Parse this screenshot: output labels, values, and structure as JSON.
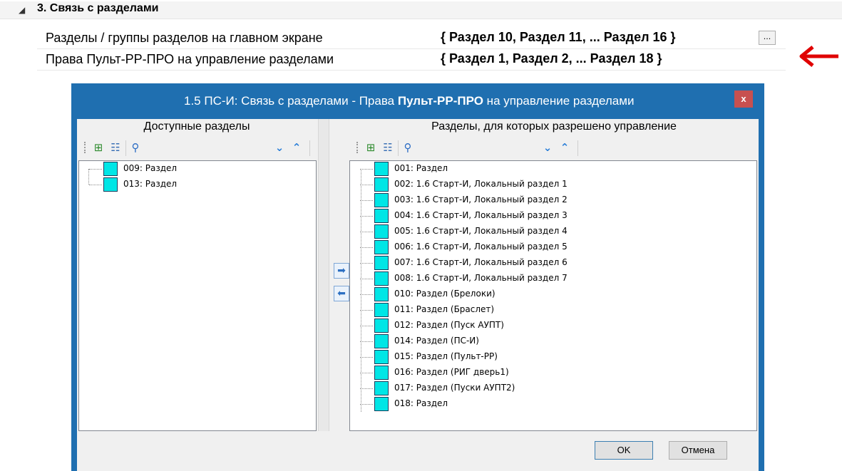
{
  "property_grid": {
    "group_title": "3. Связь с разделами",
    "rows": [
      {
        "name": "Разделы / группы разделов на главном экране",
        "value": "{ Раздел 10, Раздел 11, ... Раздел 16 }",
        "button": "..."
      },
      {
        "name": "Права Пульт-РР-ПРО на управление разделами",
        "value": "{ Раздел 1, Раздел 2, ... Раздел 18 }"
      }
    ]
  },
  "dialog": {
    "title_pre": "1.5 ПС-И: Связь с разделами - Права ",
    "title_bold": "Пульт-РР-ПРО",
    "title_post": " на управление разделами",
    "close": "x",
    "left_header": "Доступные разделы",
    "right_header": "Разделы, для которых разрешено управление",
    "available": [
      "009: Раздел",
      "013: Раздел"
    ],
    "allowed": [
      "001: Раздел",
      "002: 1.6 Старт-И, Локальный раздел 1",
      "003: 1.6 Старт-И, Локальный раздел 2",
      "004: 1.6 Старт-И, Локальный раздел 3",
      "005: 1.6 Старт-И, Локальный раздел 4",
      "006: 1.6 Старт-И, Локальный раздел 5",
      "007: 1.6 Старт-И, Локальный раздел 6",
      "008: 1.6 Старт-И, Локальный раздел 7",
      "010: Раздел (Брелоки)",
      "011: Раздел (Браслет)",
      "012: Раздел (Пуск АУПТ)",
      "014: Раздел (ПС-И)",
      "015: Раздел (Пульт-РР)",
      "016: Раздел (РИГ дверь1)",
      "017: Раздел (Пуски АУПТ2)",
      "018: Раздел"
    ],
    "ok": "OK",
    "cancel": "Отмена"
  },
  "icons": {
    "expand": "expand-all-icon",
    "collapse": "collapse-all-icon",
    "search": "magnifier-icon",
    "down": "chevron-down-icon",
    "up": "chevron-up-icon",
    "move_right": "arrow-right-icon",
    "move_left": "arrow-left-icon"
  },
  "colors": {
    "titlebar": "#1f6fb0",
    "node_square": "#00e6e6",
    "annotation_arrow": "#e00000",
    "close_button": "#c75050"
  }
}
